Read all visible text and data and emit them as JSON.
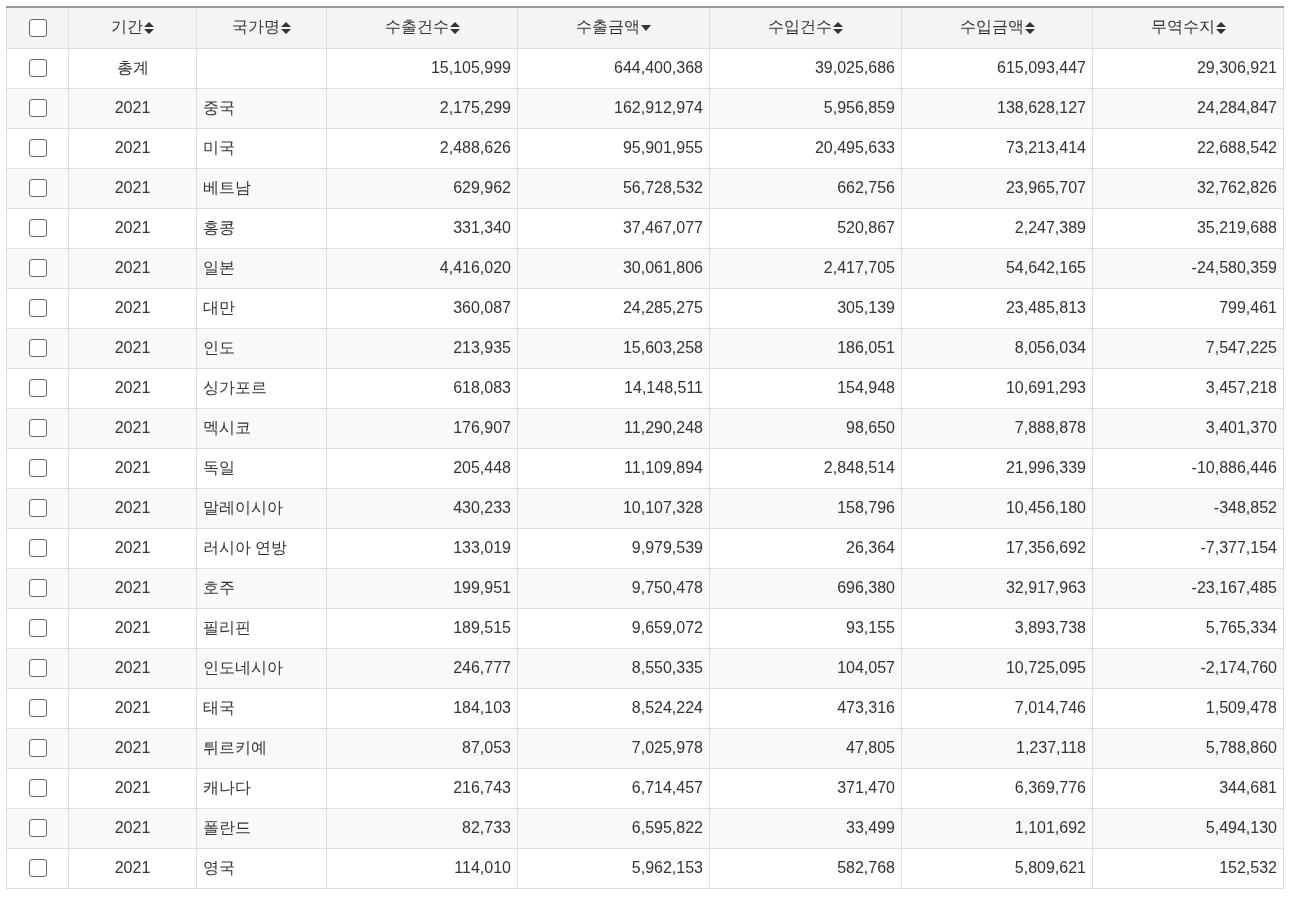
{
  "table": {
    "select_all": {
      "checked": false
    },
    "columns": [
      {
        "label": "기간",
        "sorted": false
      },
      {
        "label": "국가명",
        "sorted": false
      },
      {
        "label": "수출건수",
        "sorted": false
      },
      {
        "label": "수출금액",
        "sorted": true
      },
      {
        "label": "수입건수",
        "sorted": false
      },
      {
        "label": "수입금액",
        "sorted": false
      },
      {
        "label": "무역수지",
        "sorted": false
      }
    ],
    "rows": [
      {
        "checked": false,
        "cells": [
          "총계",
          null,
          "15,105,999",
          "644,400,368",
          "39,025,686",
          "615,093,447",
          "29,306,921"
        ]
      },
      {
        "checked": false,
        "cells": [
          "2021",
          "중국",
          "2,175,299",
          "162,912,974",
          "5,956,859",
          "138,628,127",
          "24,284,847"
        ]
      },
      {
        "checked": false,
        "cells": [
          "2021",
          "미국",
          "2,488,626",
          "95,901,955",
          "20,495,633",
          "73,213,414",
          "22,688,542"
        ]
      },
      {
        "checked": false,
        "cells": [
          "2021",
          "베트남",
          "629,962",
          "56,728,532",
          "662,756",
          "23,965,707",
          "32,762,826"
        ]
      },
      {
        "checked": false,
        "cells": [
          "2021",
          "홍콩",
          "331,340",
          "37,467,077",
          "520,867",
          "2,247,389",
          "35,219,688"
        ]
      },
      {
        "checked": false,
        "cells": [
          "2021",
          "일본",
          "4,416,020",
          "30,061,806",
          "2,417,705",
          "54,642,165",
          "-24,580,359"
        ]
      },
      {
        "checked": false,
        "cells": [
          "2021",
          "대만",
          "360,087",
          "24,285,275",
          "305,139",
          "23,485,813",
          "799,461"
        ]
      },
      {
        "checked": false,
        "cells": [
          "2021",
          "인도",
          "213,935",
          "15,603,258",
          "186,051",
          "8,056,034",
          "7,547,225"
        ]
      },
      {
        "checked": false,
        "cells": [
          "2021",
          "싱가포르",
          "618,083",
          "14,148,511",
          "154,948",
          "10,691,293",
          "3,457,218"
        ]
      },
      {
        "checked": false,
        "cells": [
          "2021",
          "멕시코",
          "176,907",
          "11,290,248",
          "98,650",
          "7,888,878",
          "3,401,370"
        ]
      },
      {
        "checked": false,
        "cells": [
          "2021",
          "독일",
          "205,448",
          "11,109,894",
          "2,848,514",
          "21,996,339",
          "-10,886,446"
        ]
      },
      {
        "checked": false,
        "cells": [
          "2021",
          "말레이시아",
          "430,233",
          "10,107,328",
          "158,796",
          "10,456,180",
          "-348,852"
        ]
      },
      {
        "checked": false,
        "cells": [
          "2021",
          "러시아 연방",
          "133,019",
          "9,979,539",
          "26,364",
          "17,356,692",
          "-7,377,154"
        ]
      },
      {
        "checked": false,
        "cells": [
          "2021",
          "호주",
          "199,951",
          "9,750,478",
          "696,380",
          "32,917,963",
          "-23,167,485"
        ]
      },
      {
        "checked": false,
        "cells": [
          "2021",
          "필리핀",
          "189,515",
          "9,659,072",
          "93,155",
          "3,893,738",
          "5,765,334"
        ]
      },
      {
        "checked": false,
        "cells": [
          "2021",
          "인도네시아",
          "246,777",
          "8,550,335",
          "104,057",
          "10,725,095",
          "-2,174,760"
        ]
      },
      {
        "checked": false,
        "cells": [
          "2021",
          "태국",
          "184,103",
          "8,524,224",
          "473,316",
          "7,014,746",
          "1,509,478"
        ]
      },
      {
        "checked": false,
        "cells": [
          "2021",
          "튀르키예",
          "87,053",
          "7,025,978",
          "47,805",
          "1,237,118",
          "5,788,860"
        ]
      },
      {
        "checked": false,
        "cells": [
          "2021",
          "캐나다",
          "216,743",
          "6,714,457",
          "371,470",
          "6,369,776",
          "344,681"
        ]
      },
      {
        "checked": false,
        "cells": [
          "2021",
          "폴란드",
          "82,733",
          "6,595,822",
          "33,499",
          "1,101,692",
          "5,494,130"
        ]
      },
      {
        "checked": false,
        "cells": [
          "2021",
          "영국",
          "114,010",
          "5,962,153",
          "582,768",
          "5,809,621",
          "152,532"
        ]
      }
    ]
  }
}
